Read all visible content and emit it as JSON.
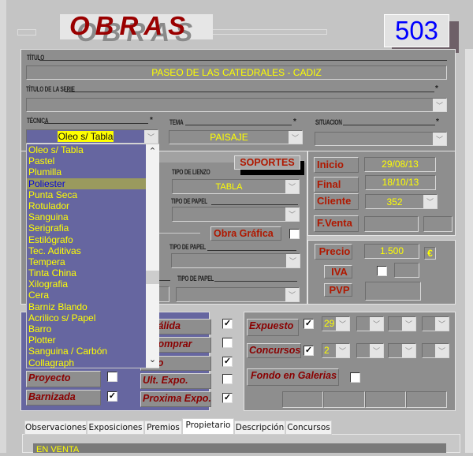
{
  "header": {
    "title": "OBRAS",
    "record_number": "503"
  },
  "form": {
    "titulo_label": "TÍTULO",
    "titulo_value": "PASEO DE LAS CATEDRALES - CADIZ",
    "serie_label": "TÍTULO DE LA SERIE",
    "serie_value": "",
    "tecnica_label": "TÉCNICA",
    "tecnica_value": "Oleo s/ Tabla",
    "tema_label": "TEMA",
    "tema_value": "PAISAJE",
    "situacion_label": "SITUACION",
    "situacion_value": "",
    "required_mark": "*"
  },
  "tecnica_dropdown": {
    "items": [
      "Oleo s/ Tabla",
      "Pastel",
      "Plumilla",
      "Poliester",
      "Punta Seca",
      "Rotulador",
      "Sanguina",
      "Serigrafia",
      "Estilógrafo",
      "Tec. Aditivas",
      "Tempera",
      "Tinta China",
      "Xilografia",
      "Cera",
      "Barniz Blando",
      "Acrilico s/ Papel",
      "Barro",
      "Plotter",
      "Sanguina / Carbón",
      "Collagraph"
    ],
    "highlighted": "Poliester"
  },
  "soportes": {
    "button": "SOPORTES",
    "tipo_lienzo_label": "TIPO DE LIENZO",
    "tipo_lienzo_value": "TABLA",
    "tipo_papel_label_1": "TIPO DE  PAPEL",
    "obra_grafica_label": "Obra Gráfica",
    "tipo_papel_label_2": "TIPO DE PAPEL",
    "tipo_papel_label_3": "TIPO DE PAPEL"
  },
  "dates": {
    "inicio_label": "Inicio",
    "inicio_value": "29/08/13",
    "final_label": "Final",
    "final_value": "18/10/13",
    "cliente_label": "Cliente",
    "cliente_value": "352",
    "fventa_label": "F.Venta"
  },
  "price": {
    "precio_label": "Precio",
    "precio_value": "1.500",
    "currency": "€",
    "iva_label": "IVA",
    "pvp_label": "PVP"
  },
  "flags": {
    "proyecto": "Proyecto",
    "barnizada": "Barnizada",
    "valida": "o Válida",
    "comprar": "a Comprar",
    "vendido": "dido",
    "ult_expo": "Ult. Expo.",
    "proxima_expo": "Proxima Expo."
  },
  "expo": {
    "expuesto_label": "Expuesto",
    "expuesto_value": "29",
    "concursos_label": "Concursos",
    "concursos_value": "2",
    "fondo_label": "Fondo en Galerias"
  },
  "tabs": [
    "Observaciones",
    "Exposiciones",
    "Premios",
    "Propietario",
    "Descripción",
    "Concursos"
  ],
  "tab_content": {
    "status": "EN VENTA"
  },
  "colors": {
    "panel": "#8e8e8e",
    "blue_panel": "#6666a0",
    "field_text": "#ffff00",
    "label_red": "#b01800",
    "number": "#0000ff"
  }
}
